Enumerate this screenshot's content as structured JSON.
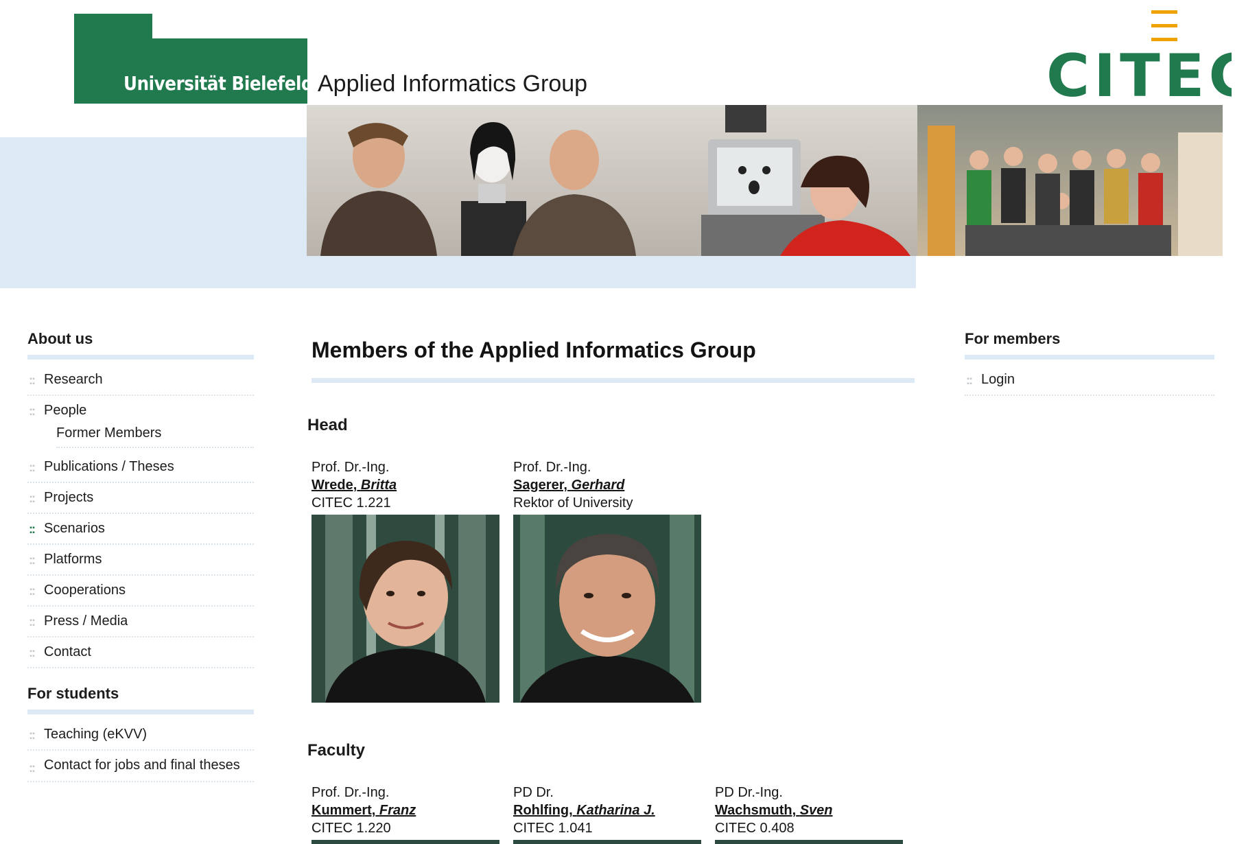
{
  "header": {
    "university": "Universität Bielefeld",
    "group": "Applied Informatics Group",
    "partner_logo": "CITEC"
  },
  "left_nav": {
    "about_heading": "About us",
    "about_items": [
      {
        "label": "Research"
      },
      {
        "label": "People",
        "sub": "Former Members"
      },
      {
        "label": "Publications / Theses"
      },
      {
        "label": "Projects"
      },
      {
        "label": "Scenarios",
        "active": true
      },
      {
        "label": "Platforms"
      },
      {
        "label": "Cooperations"
      },
      {
        "label": "Press / Media"
      },
      {
        "label": "Contact"
      }
    ],
    "students_heading": "For students",
    "students_items": [
      {
        "label": "Teaching (eKVV)"
      },
      {
        "label": "Contact for jobs and final theses"
      }
    ],
    "bullet": "::"
  },
  "main": {
    "title": "Members of the Applied Informatics Group",
    "head_heading": "Head",
    "head": [
      {
        "title": "Prof. Dr.-Ing.",
        "last": "Wrede,",
        "first": "Britta",
        "room": "CITEC 1.221"
      },
      {
        "title": "Prof. Dr.-Ing.",
        "last": "Sagerer,",
        "first": "Gerhard",
        "room": "Rektor of University"
      }
    ],
    "faculty_heading": "Faculty",
    "faculty": [
      {
        "title": "Prof. Dr.-Ing.",
        "last": "Kummert,",
        "first": "Franz",
        "room": "CITEC 1.220"
      },
      {
        "title": "PD Dr.",
        "last": "Rohlfing,",
        "first": "Katharina J.",
        "room": "CITEC 1.041"
      },
      {
        "title": "PD Dr.-Ing.",
        "last": "Wachsmuth,",
        "first": "Sven",
        "room": "CITEC 0.408"
      }
    ]
  },
  "right_nav": {
    "heading": "For members",
    "items": [
      {
        "label": "Login"
      }
    ]
  },
  "colors": {
    "uni_green": "#21794e",
    "band_blue": "#dde9f5",
    "citec_orange": "#f0a300"
  }
}
